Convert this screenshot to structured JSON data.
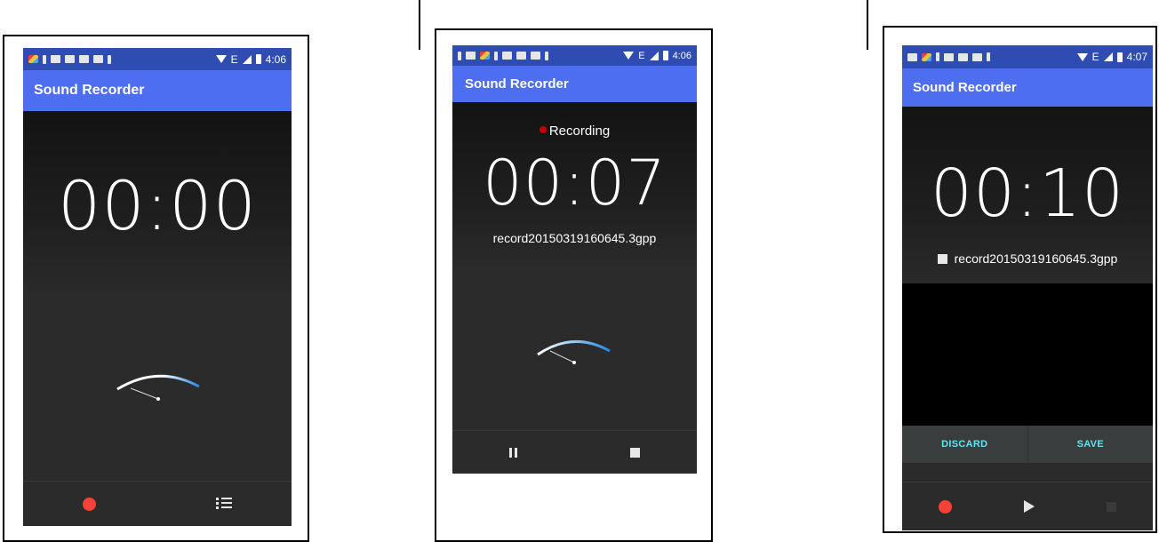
{
  "status_bar": {
    "screen1_time": "4:06",
    "screen2_time": "4:06",
    "screen3_time": "4:07",
    "network": "E"
  },
  "app": {
    "title": "Sound Recorder"
  },
  "screen1": {
    "timer": "00:00",
    "record_button_icon": "record-icon",
    "list_button_icon": "list-icon"
  },
  "screen2": {
    "status": "Recording",
    "timer": "00:07",
    "filename": "record20150319160645.3gpp",
    "pause_button_icon": "pause-icon",
    "stop_button_icon": "stop-icon"
  },
  "screen3": {
    "timer": "00:10",
    "filename": "record20150319160645.3gpp",
    "discard_label": "DISCARD",
    "save_label": "SAVE",
    "record_button_icon": "record-icon",
    "play_button_icon": "play-icon",
    "stop_button_icon": "stop-icon"
  },
  "colors": {
    "app_bar": "#4e6ef2",
    "status_bar": "#2f4cb2",
    "record": "#f44336",
    "action_text": "#5ee6ee"
  }
}
